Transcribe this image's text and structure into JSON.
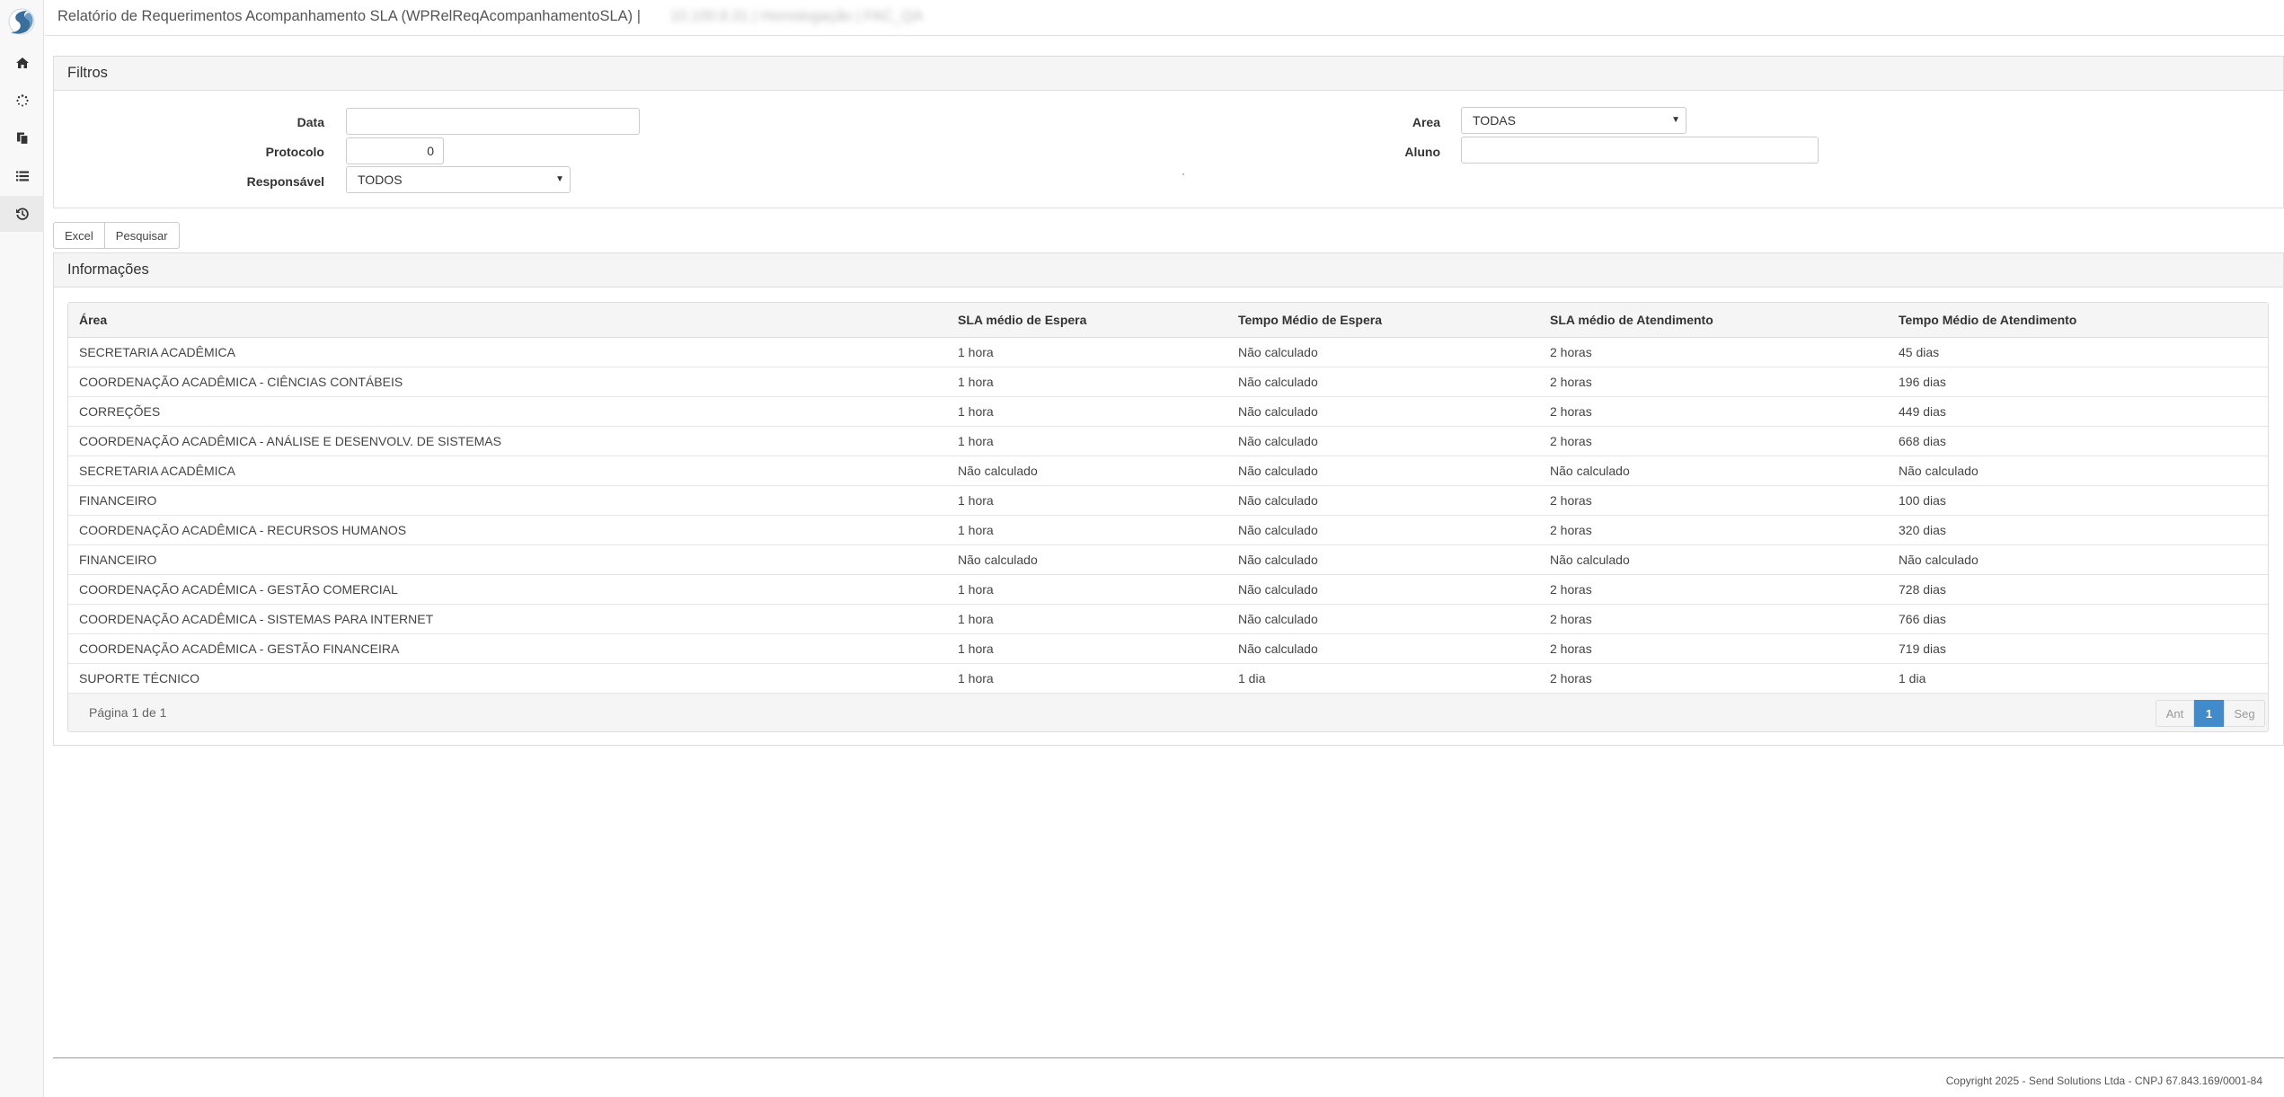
{
  "header": {
    "title": "Relatório de Requerimentos Acompanhamento SLA (WPRelReqAcompanhamentoSLA) |",
    "environment": "10.100.8.31 | Homologação | FAC_QA"
  },
  "sidebar": {
    "items": [
      {
        "icon": "home-icon"
      },
      {
        "icon": "spinner-icon"
      },
      {
        "icon": "copy-icon"
      },
      {
        "icon": "list-icon"
      },
      {
        "icon": "history-icon"
      }
    ]
  },
  "filters": {
    "title": "Filtros",
    "data_label": "Data",
    "data_value": "",
    "protocolo_label": "Protocolo",
    "protocolo_value": "0",
    "responsavel_label": "Responsável",
    "responsavel_value": "TODOS",
    "area_label": "Area",
    "area_value": "TODAS",
    "aluno_label": "Aluno",
    "aluno_value": ""
  },
  "actions": {
    "excel_label": "Excel",
    "pesquisar_label": "Pesquisar"
  },
  "informacoes": {
    "title": "Informações",
    "columns": [
      "Área",
      "SLA médio de Espera",
      "Tempo Médio de Espera",
      "SLA médio de Atendimento",
      "Tempo Médio de Atendimento"
    ],
    "rows": [
      [
        "SECRETARIA ACADÊMICA",
        "1 hora",
        "Não calculado",
        "2 horas",
        "45 dias"
      ],
      [
        "COORDENAÇÃO ACADÊMICA - CIÊNCIAS CONTÁBEIS",
        "1 hora",
        "Não calculado",
        "2 horas",
        "196 dias"
      ],
      [
        "CORREÇÕES",
        "1 hora",
        "Não calculado",
        "2 horas",
        "449 dias"
      ],
      [
        "COORDENAÇÃO ACADÊMICA - ANÁLISE E DESENVOLV. DE SISTEMAS",
        "1 hora",
        "Não calculado",
        "2 horas",
        "668 dias"
      ],
      [
        "SECRETARIA ACADÊMICA",
        "Não calculado",
        "Não calculado",
        "Não calculado",
        "Não calculado"
      ],
      [
        "FINANCEIRO",
        "1 hora",
        "Não calculado",
        "2 horas",
        "100 dias"
      ],
      [
        "COORDENAÇÃO ACADÊMICA - RECURSOS HUMANOS",
        "1 hora",
        "Não calculado",
        "2 horas",
        "320 dias"
      ],
      [
        "FINANCEIRO",
        "Não calculado",
        "Não calculado",
        "Não calculado",
        "Não calculado"
      ],
      [
        "COORDENAÇÃO ACADÊMICA - GESTÃO COMERCIAL",
        "1 hora",
        "Não calculado",
        "2 horas",
        "728 dias"
      ],
      [
        "COORDENAÇÃO ACADÊMICA - SISTEMAS PARA INTERNET",
        "1 hora",
        "Não calculado",
        "2 horas",
        "766 dias"
      ],
      [
        "COORDENAÇÃO ACADÊMICA - GESTÃO FINANCEIRA",
        "1 hora",
        "Não calculado",
        "2 horas",
        "719 dias"
      ],
      [
        "SUPORTE TÉCNICO",
        "1 hora",
        "1 dia",
        "2 horas",
        "1 dia"
      ]
    ],
    "pager_text": "Página 1 de 1",
    "prev_label": "Ant",
    "current_page": "1",
    "next_label": "Seg"
  },
  "footer": {
    "copyright": "Copyright 2025 - Send Solutions Ltda - CNPJ 67.843.169/0001-84"
  },
  "colors": {
    "accent": "#428bca",
    "logo": "#3a6e9c"
  }
}
